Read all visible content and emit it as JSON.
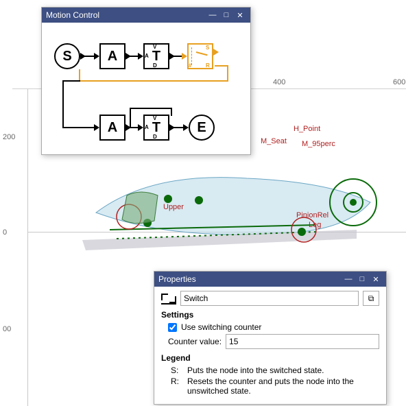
{
  "motionPanel": {
    "title": "Motion Control"
  },
  "propsPanel": {
    "title": "Properties",
    "name": "Switch",
    "settingsHeading": "Settings",
    "useCounterLabel": "Use switching counter",
    "useCounterChecked": true,
    "counterLabel": "Counter value:",
    "counterValue": "15",
    "legendHeading": "Legend",
    "legend": [
      {
        "k": "S:",
        "v": "Puts the node into the switched state."
      },
      {
        "k": "R:",
        "v": "Resets the counter and puts the node into the unswitched state."
      }
    ]
  },
  "ruler": {
    "ticks": [
      "400",
      "600"
    ]
  },
  "vticks": [
    "200",
    "0",
    "00"
  ],
  "annots": {
    "hpoint": "H_Point",
    "mseat": "M_Seat",
    "m95": "M_95perc",
    "upper": "Upper",
    "leg": "Leg",
    "pinion": "PinionRel"
  },
  "blocks": {
    "row1": [
      "S",
      "A",
      "T"
    ],
    "row2": [
      "A",
      "T",
      "E"
    ],
    "tports": {
      "top": "V",
      "mid": "A",
      "bot": "D"
    },
    "switch": {
      "s": "S",
      "hash": "#",
      "r": "R"
    }
  },
  "winBtns": {
    "min": "—",
    "max": "□",
    "close": "✕"
  }
}
